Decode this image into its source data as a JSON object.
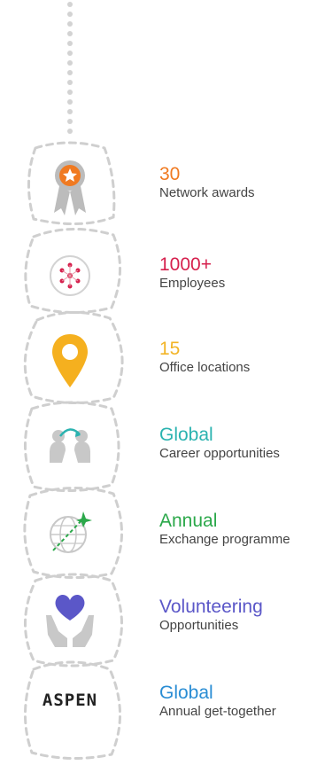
{
  "stats": [
    {
      "value": "30",
      "label": "Network awards",
      "color": "#f07a21",
      "icon": "award-ribbon-icon"
    },
    {
      "value": "1000+",
      "label": "Employees",
      "color": "#d6204d",
      "icon": "people-network-icon"
    },
    {
      "value": "15",
      "label": "Office locations",
      "color": "#f2b427",
      "icon": "location-pin-icon"
    },
    {
      "value": "Global",
      "label": "Career opportunities",
      "color": "#2bb3b0",
      "icon": "career-arrow-icon"
    },
    {
      "value": "Annual",
      "label": "Exchange programme",
      "color": "#2ba84a",
      "icon": "globe-plane-icon"
    },
    {
      "value": "Volunteering",
      "label": "Opportunities",
      "color": "#5b57c8",
      "icon": "heart-hands-icon"
    },
    {
      "value": "Global",
      "label": "Annual get-together",
      "color": "#2a8dd4",
      "icon": "aspen-logo-icon",
      "logo_text": "ASPEN"
    }
  ]
}
